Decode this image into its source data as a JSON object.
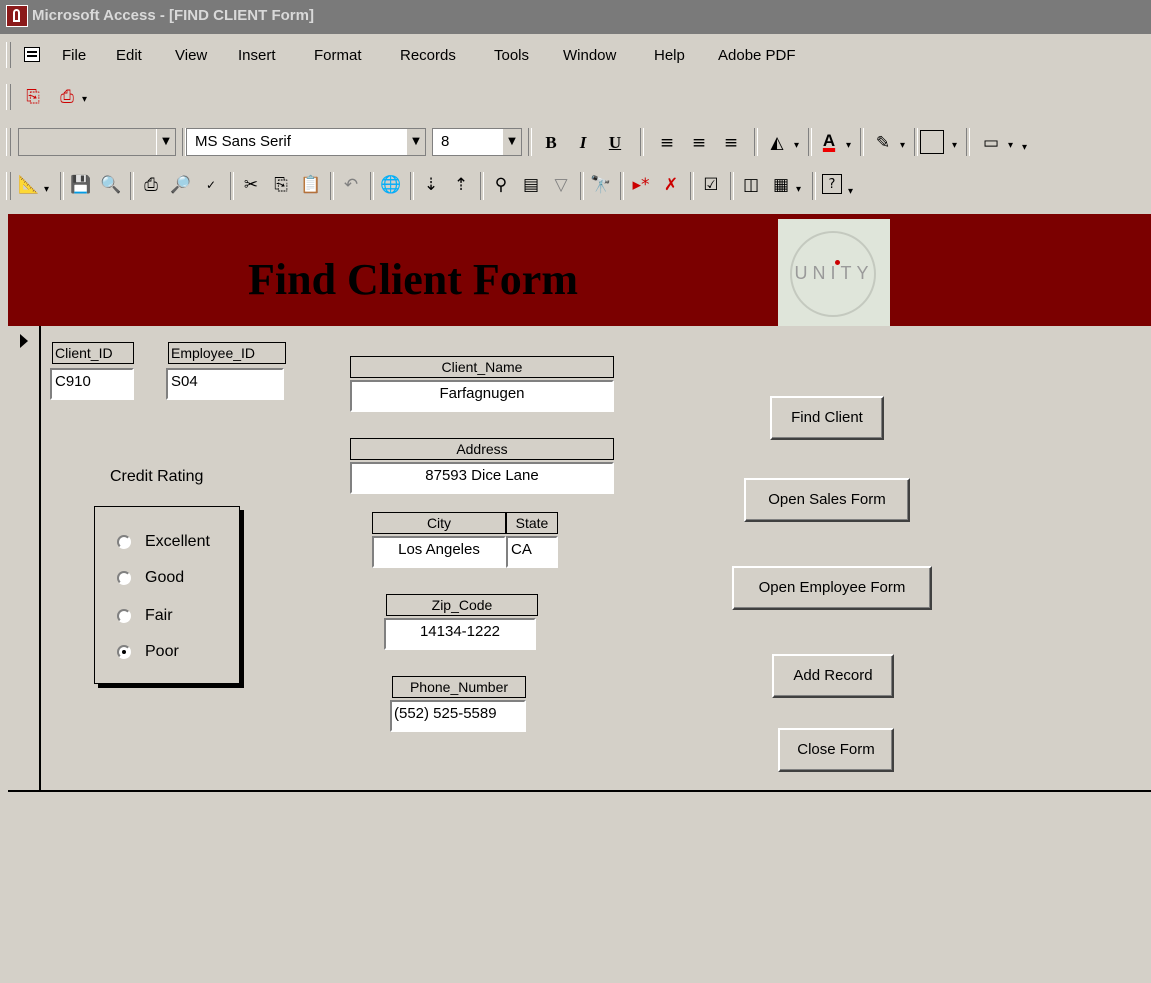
{
  "window": {
    "title": "Microsoft Access - [FIND CLIENT Form]"
  },
  "menu": [
    {
      "label": "File"
    },
    {
      "label": "Edit"
    },
    {
      "label": "View"
    },
    {
      "label": "Insert"
    },
    {
      "label": "Format"
    },
    {
      "label": "Records"
    },
    {
      "label": "Tools"
    },
    {
      "label": "Window"
    },
    {
      "label": "Help"
    },
    {
      "label": "Adobe PDF"
    }
  ],
  "formatting": {
    "object": "",
    "font": "MS Sans Serif",
    "size": "8",
    "bold": "B",
    "italic": "I",
    "underline": "U",
    "font_color_glyph": "A"
  },
  "toolbar_icons": [
    "design-view-icon",
    "save-icon",
    "search-web-icon",
    "print-icon",
    "print-preview-icon",
    "spelling-icon",
    "cut-icon",
    "copy-icon",
    "paste-icon",
    "undo-icon",
    "hyperlink-icon",
    "sort-ascending-icon",
    "sort-descending-icon",
    "filter-by-selection-icon",
    "filter-by-form-icon",
    "apply-filter-icon",
    "find-icon",
    "new-record-icon",
    "delete-record-icon",
    "properties-icon",
    "database-window-icon",
    "new-object-icon",
    "help-icon"
  ],
  "form": {
    "title": "Find Client Form",
    "logo_text": "UNITY",
    "client_id": {
      "label": "Client_ID",
      "value": "C910"
    },
    "employee_id": {
      "label": "Employee_ID",
      "value": "S04"
    },
    "client_name": {
      "label": "Client_Name",
      "value": "Farfagnugen"
    },
    "address": {
      "label": "Address",
      "value": "87593 Dice Lane"
    },
    "city": {
      "label": "City",
      "value": "Los Angeles"
    },
    "state": {
      "label": "State",
      "value": "CA"
    },
    "zip": {
      "label": "Zip_Code",
      "value": "14134-1222"
    },
    "phone": {
      "label": "Phone_Number",
      "value": "(552) 525-5589"
    },
    "credit_rating": {
      "label": "Credit Rating",
      "options": [
        "Excellent",
        "Good",
        "Fair",
        "Poor"
      ],
      "selected": "Poor"
    },
    "buttons": {
      "find": "Find Client",
      "sales": "Open Sales Form",
      "employee": "Open Employee Form",
      "add": "Add Record",
      "close": "Close Form"
    }
  }
}
